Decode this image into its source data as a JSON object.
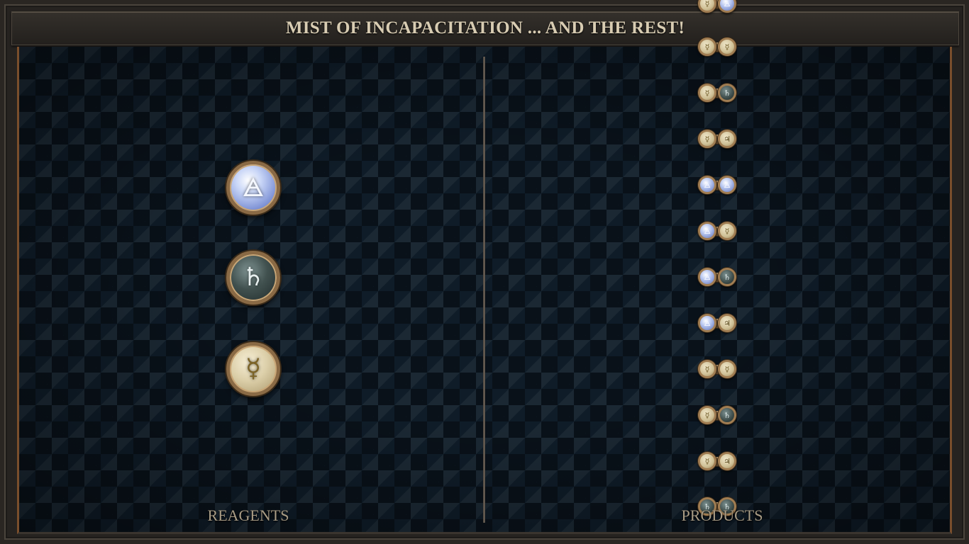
{
  "header": {
    "title": "MIST OF INCAPACITATION ... AND THE REST!"
  },
  "labels": {
    "reagents": "REAGENTS",
    "products": "PRODUCTS"
  },
  "reagents": [
    {
      "name": "air",
      "glyph": "🜁"
    },
    {
      "name": "lead",
      "glyph": "♄"
    },
    {
      "name": "mercury",
      "glyph": "☿"
    }
  ],
  "products": [
    {
      "left": "mercury",
      "left_glyph": "☿",
      "right": "air",
      "right_glyph": "🜁"
    },
    {
      "left": "mercury",
      "left_glyph": "☿",
      "right": "mercury",
      "right_glyph": "☿"
    },
    {
      "left": "mercury",
      "left_glyph": "☿",
      "right": "lead",
      "right_glyph": "♄"
    },
    {
      "left": "mercury",
      "left_glyph": "☿",
      "right": "jupiter",
      "right_glyph": "♃"
    },
    {
      "left": "air",
      "left_glyph": "🜁",
      "right": "air",
      "right_glyph": "🜁"
    },
    {
      "left": "air",
      "left_glyph": "🜁",
      "right": "mercury",
      "right_glyph": "☿"
    },
    {
      "left": "air",
      "left_glyph": "🜁",
      "right": "lead",
      "right_glyph": "♄"
    },
    {
      "left": "air",
      "left_glyph": "🜁",
      "right": "jupiter",
      "right_glyph": "♃"
    },
    {
      "left": "mercury",
      "left_glyph": "☿",
      "right": "mercury",
      "right_glyph": "☿"
    },
    {
      "left": "mercury",
      "left_glyph": "☿",
      "right": "lead",
      "right_glyph": "♄"
    },
    {
      "left": "mercury",
      "left_glyph": "☿",
      "right": "jupiter",
      "right_glyph": "♃"
    },
    {
      "left": "lead",
      "left_glyph": "♄",
      "right": "lead",
      "right_glyph": "♄"
    }
  ],
  "colors": {
    "frame_accent": "#7a4e2c",
    "title_text": "#d8ccb2",
    "label_text": "#a99c85",
    "panel_bg": "#0f1c28"
  }
}
